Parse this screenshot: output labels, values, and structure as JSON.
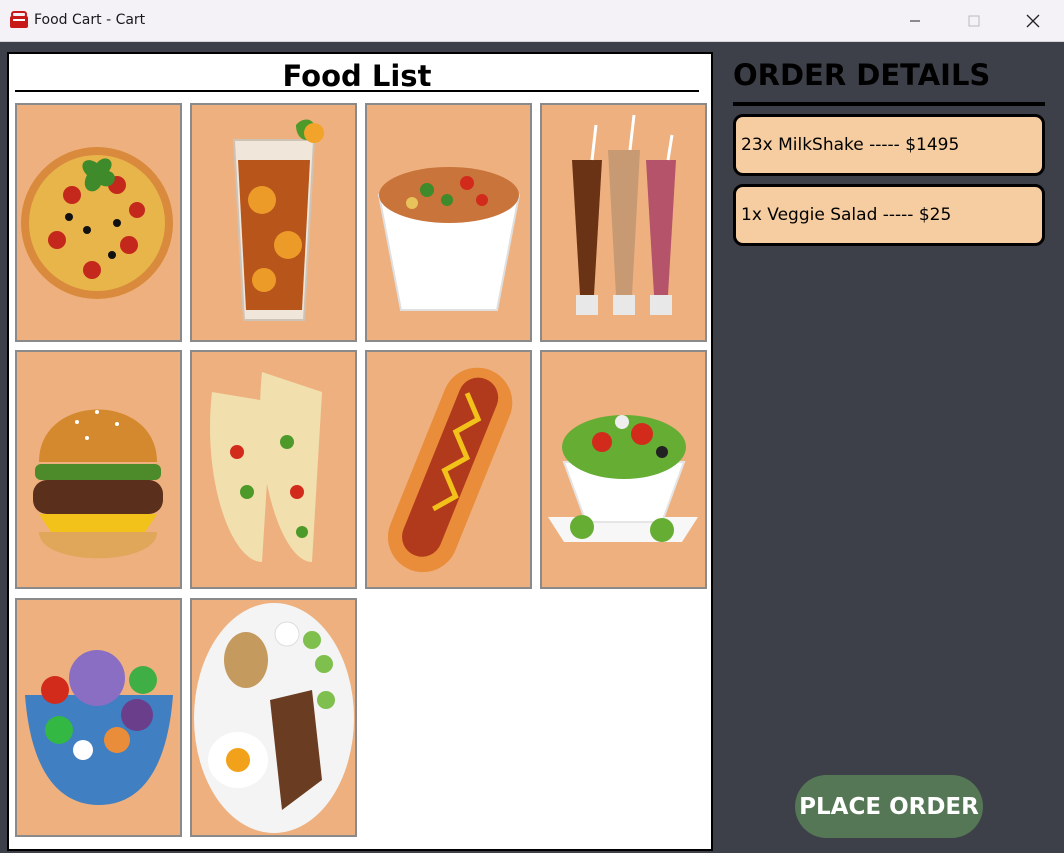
{
  "window": {
    "title": "Food Cart - Cart",
    "icon": "basket-icon",
    "controls": [
      "minimize-icon",
      "maximize-icon",
      "close-icon"
    ]
  },
  "food_list": {
    "title": "Food List",
    "items": [
      {
        "icon": "pizza-icon"
      },
      {
        "icon": "iced-tea-icon"
      },
      {
        "icon": "pasta-bowl-icon"
      },
      {
        "icon": "milkshake-icon"
      },
      {
        "icon": "burger-icon"
      },
      {
        "icon": "tacos-icon"
      },
      {
        "icon": "hotdog-icon"
      },
      {
        "icon": "veggie-salad-icon"
      },
      {
        "icon": "dessert-bowl-icon"
      },
      {
        "icon": "steak-plate-icon"
      }
    ]
  },
  "order": {
    "title": "ORDER DETAILS",
    "items": [
      {
        "text": "23x MilkShake ----- $1495"
      },
      {
        "text": "1x Veggie Salad ----- $25"
      }
    ],
    "place_label": "PLACE ORDER"
  },
  "colors": {
    "tile_background": "#eeb07e",
    "order_item_background": "#f5cda0",
    "panel_background": "#3d4048",
    "button_background": "#557755"
  }
}
